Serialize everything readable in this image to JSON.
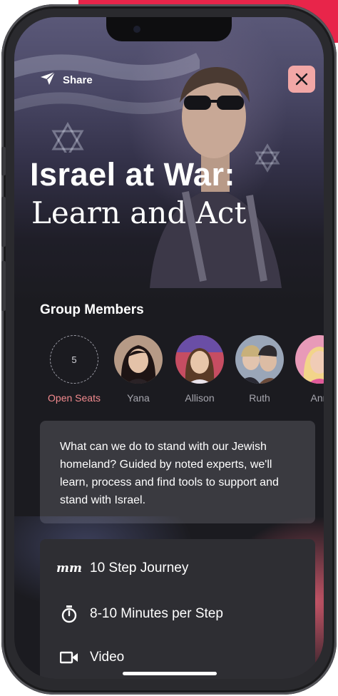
{
  "hero": {
    "share_label": "Share",
    "title_line1": "Israel at War:",
    "title_line2": "Learn and Act"
  },
  "members_section": {
    "heading": "Group Members",
    "open_seats_count": "5",
    "open_seats_label": "Open Seats",
    "members": [
      {
        "name": "Yana"
      },
      {
        "name": "Allison"
      },
      {
        "name": "Ruth"
      },
      {
        "name": "Ann"
      }
    ]
  },
  "description": "What can we do to stand with our Jewish homeland? Guided by noted experts, we'll learn, process and find tools to support and stand with Israel.",
  "details": [
    {
      "icon": "steps-icon",
      "label": "10 Step Journey"
    },
    {
      "icon": "stopwatch-icon",
      "label": "8-10 Minutes per Step"
    },
    {
      "icon": "video-camera-icon",
      "label": "Video"
    }
  ],
  "colors": {
    "accent_pink": "#e8254a",
    "close_button_bg": "#f2a7a6",
    "open_seat_text": "#f28a8e",
    "background": "#1b1b20",
    "card": "#3a3a40"
  }
}
